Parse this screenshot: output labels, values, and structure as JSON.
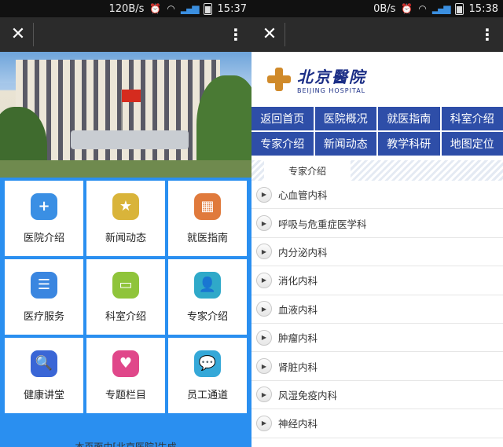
{
  "left": {
    "status": {
      "speed": "120B/s",
      "time": "15:37"
    },
    "topbar": {
      "close": "✕",
      "menu": "⋮"
    },
    "tiles": [
      {
        "label": "医院介绍",
        "icon": "plus-icon",
        "glyph": "+",
        "color": "#3a8fe4"
      },
      {
        "label": "新闻动态",
        "icon": "star-icon",
        "glyph": "★",
        "color": "#d9b43a"
      },
      {
        "label": "就医指南",
        "icon": "grid-icon",
        "glyph": "▦",
        "color": "#e07a3c"
      },
      {
        "label": "医疗服务",
        "icon": "list-icon",
        "glyph": "☰",
        "color": "#3a86e0"
      },
      {
        "label": "科室介绍",
        "icon": "card-icon",
        "glyph": "▭",
        "color": "#8fc43a"
      },
      {
        "label": "专家介绍",
        "icon": "person-icon",
        "glyph": "👤",
        "color": "#2fa9c9"
      },
      {
        "label": "健康讲堂",
        "icon": "search-icon",
        "glyph": "🔍",
        "color": "#3a66d6"
      },
      {
        "label": "专题栏目",
        "icon": "heart-icon",
        "glyph": "♥",
        "color": "#e0478a"
      },
      {
        "label": "员工通道",
        "icon": "chat-icon",
        "glyph": "💬",
        "color": "#35a8d8"
      }
    ],
    "footer": "本页面由[北京医院]生成"
  },
  "right": {
    "status": {
      "speed": "0B/s",
      "time": "15:38"
    },
    "topbar": {
      "close": "✕",
      "menu": "⋮"
    },
    "logo": {
      "cn": "北京醫院",
      "en": "BEIJING HOSPITAL"
    },
    "nav": [
      "返回首页",
      "医院概况",
      "就医指南",
      "科室介绍",
      "专家介绍",
      "新闻动态",
      "教学科研",
      "地图定位"
    ],
    "section_title": "专家介绍",
    "departments": [
      "心血管内科",
      "呼吸与危重症医学科",
      "内分泌内科",
      "消化内科",
      "血液内科",
      "肿瘤内科",
      "肾脏内科",
      "风湿免疫内科",
      "神经内科"
    ]
  }
}
